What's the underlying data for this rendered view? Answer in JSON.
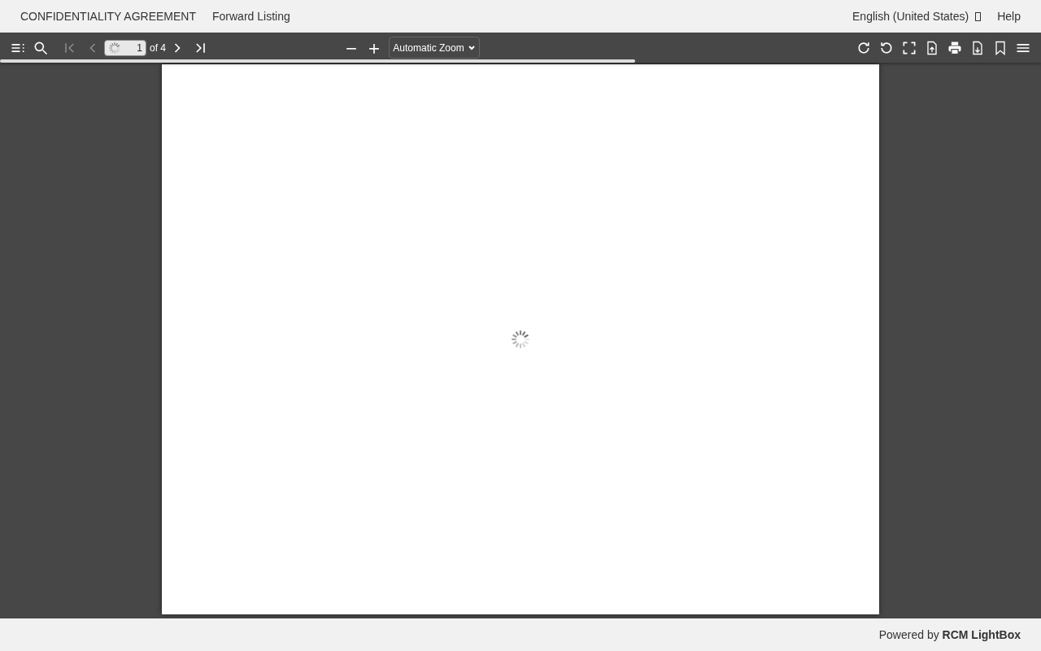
{
  "header": {
    "links": [
      {
        "label": "CONFIDENTIALITY AGREEMENT"
      },
      {
        "label": "Forward Listing"
      }
    ],
    "language": "English (United States)",
    "help": "Help"
  },
  "toolbar": {
    "page_number": "1",
    "page_count": "of 4",
    "zoom": "Automatic Zoom",
    "loading": {
      "level": 0.61
    }
  },
  "footer": {
    "prefix": "Powered by",
    "brand": "RCM LightBox"
  }
}
